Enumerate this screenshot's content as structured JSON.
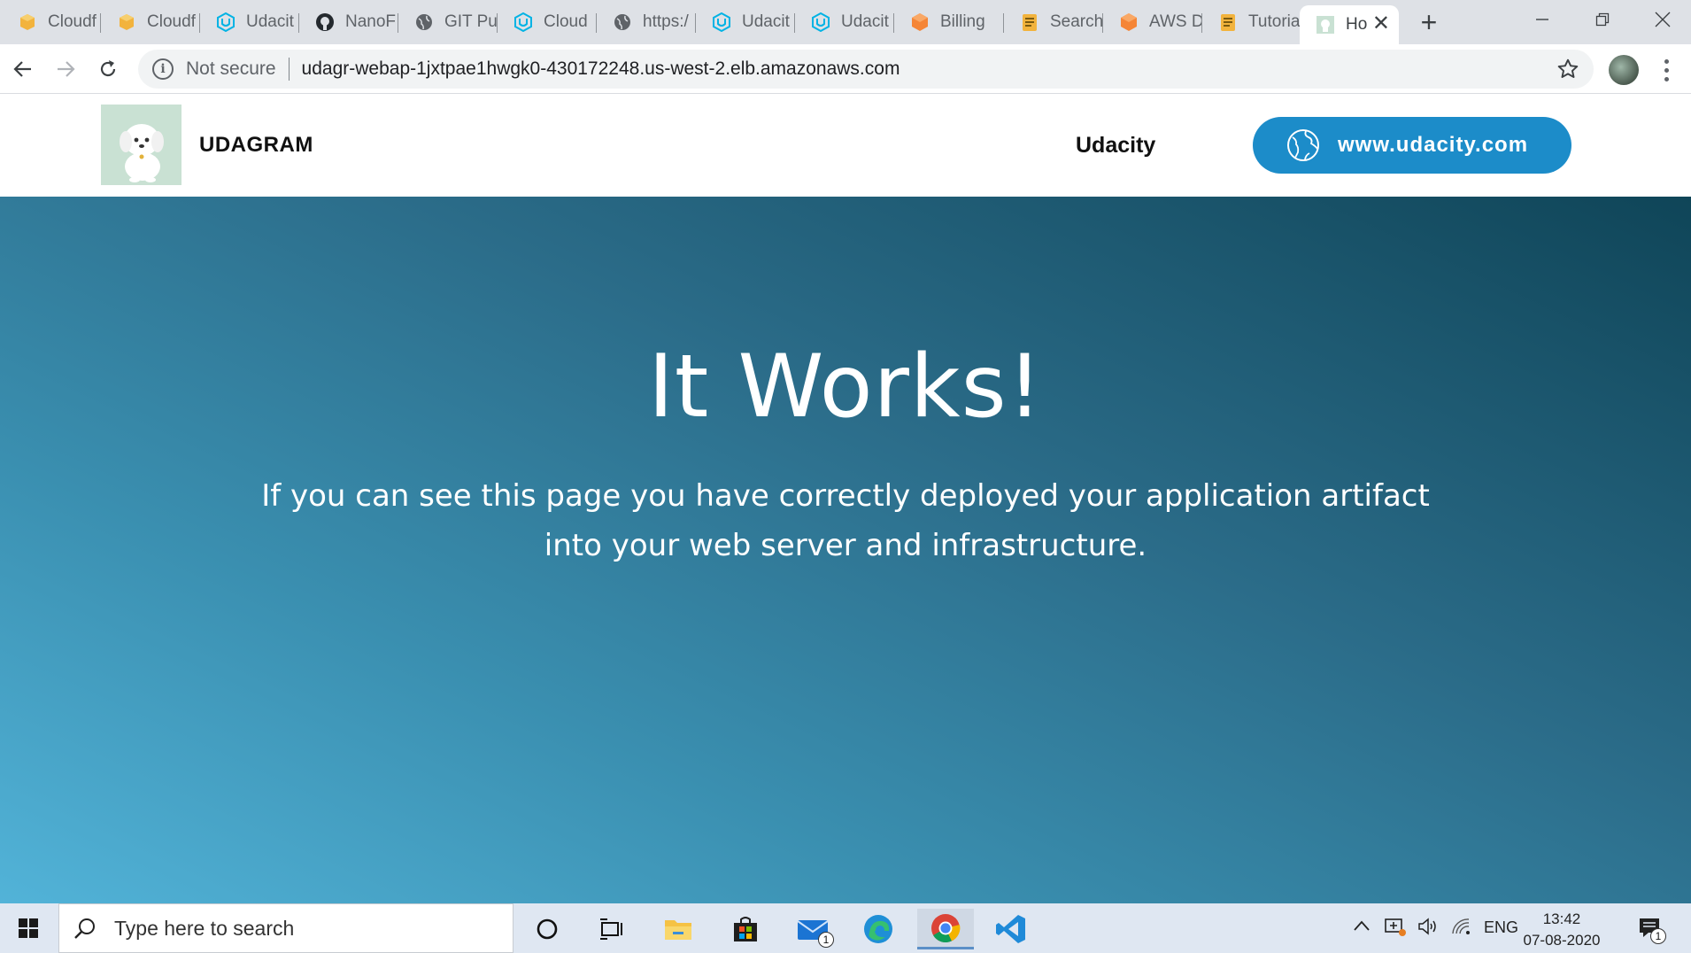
{
  "browser": {
    "tabs": [
      {
        "label": "Cloudf",
        "icon": "aws-box-icon"
      },
      {
        "label": "Cloudf",
        "icon": "aws-box-icon"
      },
      {
        "label": "Udacit",
        "icon": "udacity-icon"
      },
      {
        "label": "NanoF",
        "icon": "github-icon"
      },
      {
        "label": "GIT Pu",
        "icon": "globe-icon"
      },
      {
        "label": "Cloud",
        "icon": "udacity-icon"
      },
      {
        "label": "https:/",
        "icon": "globe-icon"
      },
      {
        "label": "Udacit",
        "icon": "udacity-icon"
      },
      {
        "label": "Udacit",
        "icon": "udacity-icon"
      },
      {
        "label": "Billing",
        "icon": "aws-orange-box-icon"
      },
      {
        "label": "Search",
        "icon": "aws-docs-icon"
      },
      {
        "label": "AWS D",
        "icon": "aws-orange-box-icon"
      },
      {
        "label": "Tutoria",
        "icon": "aws-docs-icon"
      },
      {
        "label": "Ho",
        "icon": "udagram-favicon",
        "active": true
      }
    ],
    "new_tab_symbol": "+",
    "security_label": "Not secure",
    "url": "udagr-webap-1jxtpae1hwgk0-430172248.us-west-2.elb.amazonaws.com"
  },
  "page": {
    "brand": "UDAGRAM",
    "nav_link": "Udacity",
    "cta_label": "www.udacity.com",
    "hero_title": "It Works!",
    "hero_text": "If you can see this page you have correctly deployed your application artifact into your web server and infrastructure."
  },
  "taskbar": {
    "search_placeholder": "Type here to search",
    "mail_badge": "1",
    "language": "ENG",
    "time": "13:42",
    "date": "07-08-2020",
    "notification_badge": "1"
  },
  "colors": {
    "cta_blue": "#1c8cc9",
    "hero_gradient_start": "#52b3d8",
    "hero_gradient_end": "#0f4558"
  }
}
